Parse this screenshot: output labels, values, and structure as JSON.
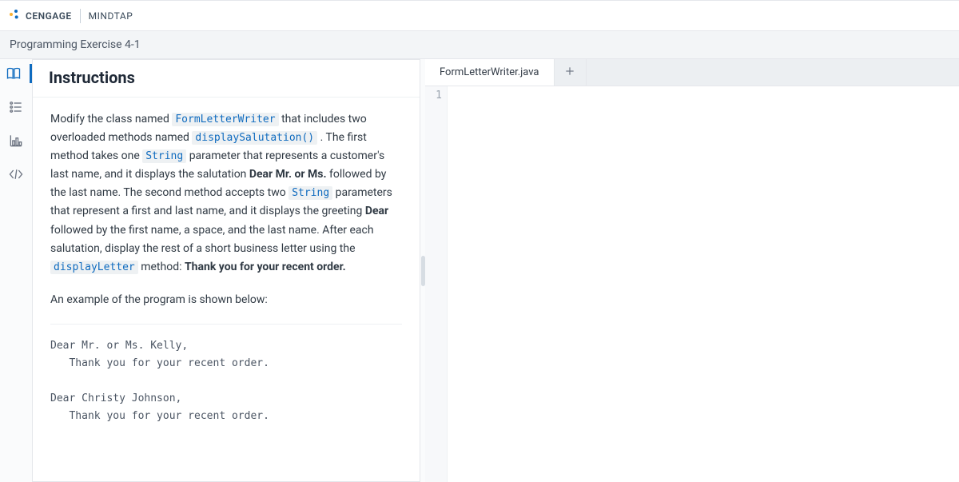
{
  "brand": {
    "cengage": "CENGAGE",
    "mindtap": "MINDTAP"
  },
  "exercise_title": "Programming Exercise 4-1",
  "sidebar_icons": {
    "book": "book-icon",
    "steps": "steps-icon",
    "chart": "chart-icon",
    "code": "code-icon"
  },
  "instructions": {
    "heading": "Instructions",
    "paragraph_intro_1": "Modify the class named ",
    "class_name": "FormLetterWriter",
    "paragraph_intro_2": " that includes two overloaded methods named ",
    "method_salutation": "displaySalutation()",
    "paragraph_intro_3": " . The first method takes one ",
    "string_type": "String",
    "paragraph_intro_4": " parameter that represents a customer's last name, and it displays the salutation ",
    "bold_salutation": "Dear Mr. or Ms.",
    "paragraph_intro_5": " followed by the last name. The second method accepts two ",
    "paragraph_intro_6": " parameters that represent a first and last name, and it displays the greeting ",
    "bold_dear": "Dear",
    "paragraph_intro_7": " followed by the first name, a space, and the last name. After each salutation, display the rest of a short business letter using the ",
    "method_letter": "displayLetter",
    "paragraph_intro_8": " method: ",
    "bold_thanks": "Thank you for your recent order.",
    "example_intro": "An example of the program is shown below:",
    "example_output": "Dear Mr. or Ms. Kelly,\n   Thank you for your recent order.\n\nDear Christy Johnson,\n   Thank you for your recent order."
  },
  "editor": {
    "tab_label": "FormLetterWriter.java",
    "line_number": "1"
  }
}
